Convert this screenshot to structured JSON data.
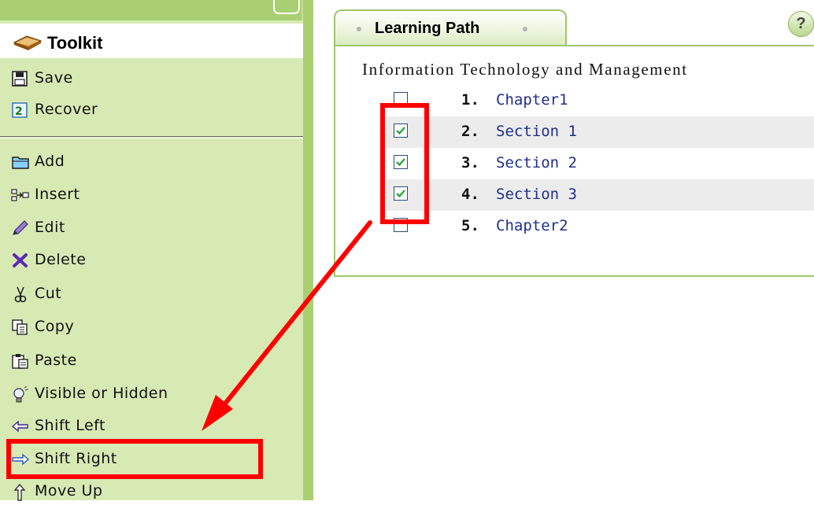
{
  "toolkit": {
    "title": "Toolkit",
    "items": [
      {
        "label": "Save",
        "icon": "floppy-disk-icon"
      },
      {
        "label": "Recover",
        "icon": "recover-icon"
      },
      {
        "label": "Add",
        "icon": "folder-icon"
      },
      {
        "label": "Insert",
        "icon": "insert-icon"
      },
      {
        "label": "Edit",
        "icon": "pencil-icon"
      },
      {
        "label": "Delete",
        "icon": "delete-x-icon"
      },
      {
        "label": "Cut",
        "icon": "scissors-icon"
      },
      {
        "label": "Copy",
        "icon": "copy-icon"
      },
      {
        "label": "Paste",
        "icon": "paste-icon"
      },
      {
        "label": "Visible or Hidden",
        "icon": "lightbulb-icon"
      },
      {
        "label": "Shift Left",
        "icon": "arrow-left-icon"
      },
      {
        "label": "Shift Right",
        "icon": "arrow-right-icon"
      },
      {
        "label": "Move Up",
        "icon": "arrow-up-icon"
      }
    ]
  },
  "learning_path": {
    "tab_label": "Learning Path",
    "help_label": "?",
    "course_title": "Information Technology and Management",
    "rows": [
      {
        "number": "1.",
        "name": "Chapter1",
        "checked": false
      },
      {
        "number": "2.",
        "name": "Section 1",
        "checked": true
      },
      {
        "number": "3.",
        "name": "Section 2",
        "checked": true
      },
      {
        "number": "4.",
        "name": "Section 3",
        "checked": true
      },
      {
        "number": "5.",
        "name": "Chapter2",
        "checked": false
      }
    ]
  },
  "colors": {
    "sidebar_bg": "#d7eab4",
    "sidebar_border": "#a9cf72",
    "link_blue": "#1f2f8c",
    "annotation_red": "#ff0000",
    "check_green": "#2aa83a"
  }
}
